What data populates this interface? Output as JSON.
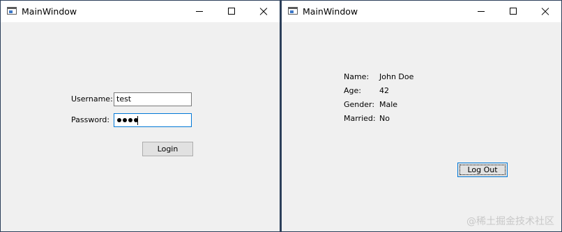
{
  "login_window": {
    "title": "MainWindow",
    "username_label": "Username:",
    "username_value": "test",
    "password_label": "Password:",
    "password_masked_length": 4,
    "login_button": "Login"
  },
  "profile_window": {
    "title": "MainWindow",
    "fields": [
      {
        "label": "Name:",
        "value": "John Doe"
      },
      {
        "label": "Age:",
        "value": "42"
      },
      {
        "label": "Gender:",
        "value": "Male"
      },
      {
        "label": "Married:",
        "value": "No"
      }
    ],
    "logout_button": "Log Out"
  },
  "watermark": "@稀土掘金技术社区"
}
